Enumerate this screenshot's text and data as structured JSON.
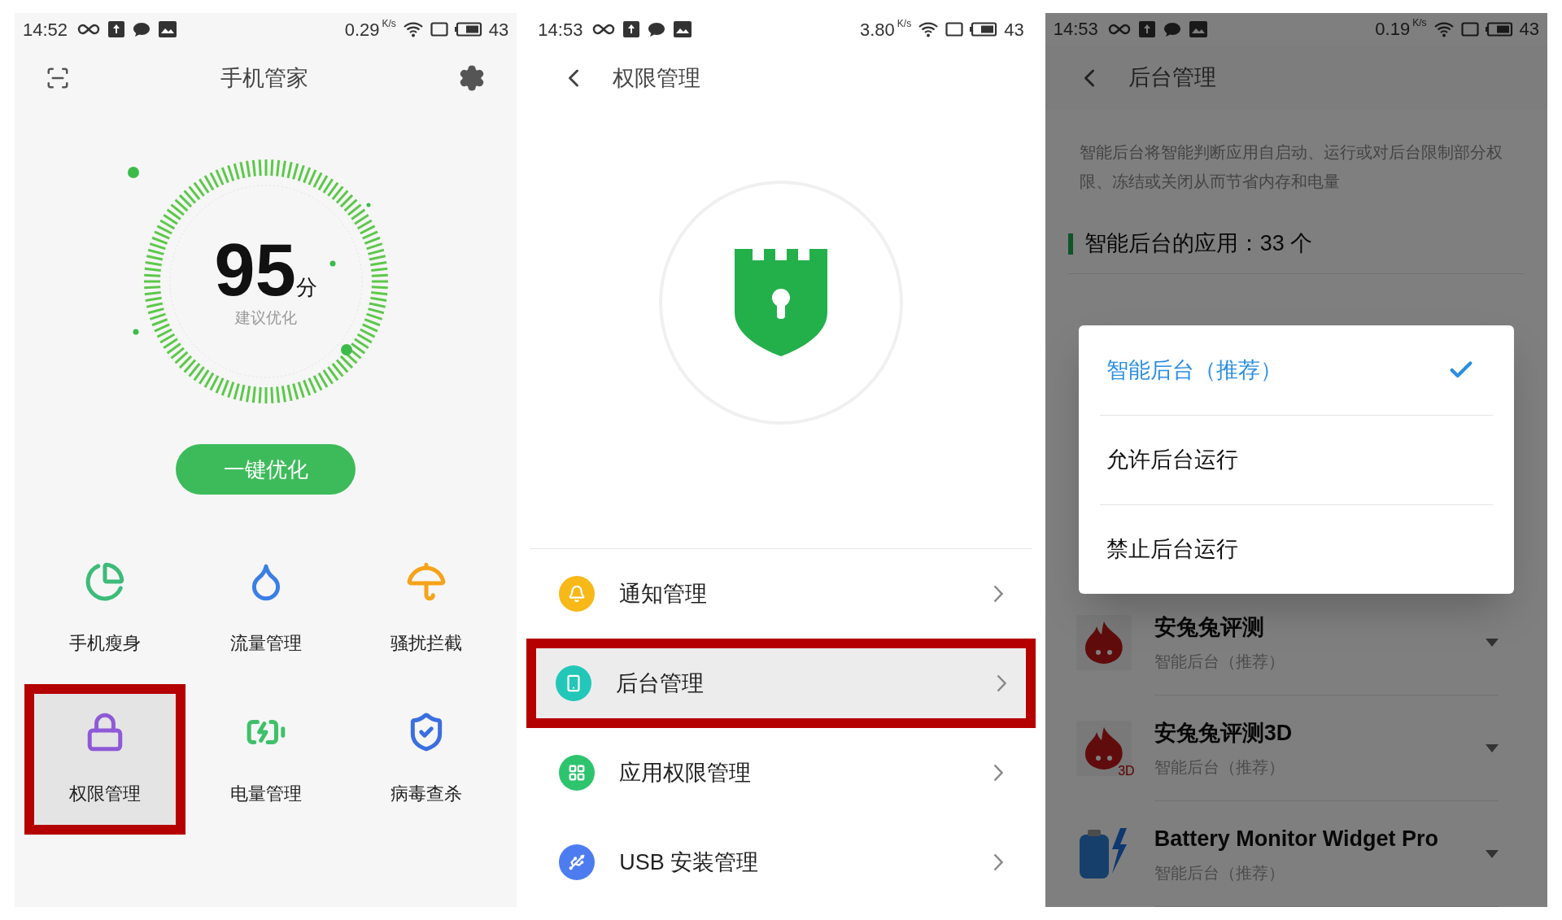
{
  "home_screen": {
    "status_bar": {
      "time": "14:52",
      "speed": "0.29",
      "speed_unit": "K/s",
      "battery": "43"
    },
    "title": "手机管家",
    "score": "95",
    "score_unit": "分",
    "score_caption": "建议优化",
    "optimize_button": "一键优化",
    "tools": [
      {
        "label": "手机瘦身",
        "kind": "pie",
        "color": "#3dbb7a",
        "highlighted": false
      },
      {
        "label": "流量管理",
        "kind": "drop",
        "color": "#3b7fe6",
        "highlighted": false
      },
      {
        "label": "骚扰拦截",
        "kind": "umbrella",
        "color": "#f5a31a",
        "highlighted": false
      },
      {
        "label": "权限管理",
        "kind": "lock",
        "color": "#8e5ad6",
        "highlighted": true
      },
      {
        "label": "电量管理",
        "kind": "battery",
        "color": "#3fc06a",
        "highlighted": false
      },
      {
        "label": "病毒查杀",
        "kind": "shield",
        "color": "#3a6fe0",
        "highlighted": false
      }
    ]
  },
  "permission_screen": {
    "status_bar": {
      "time": "14:53",
      "speed": "3.80",
      "speed_unit": "K/s",
      "battery": "43"
    },
    "title": "权限管理",
    "items": [
      {
        "label": "通知管理",
        "kind": "notice",
        "color": "#f7b818",
        "highlighted": false
      },
      {
        "label": "后台管理",
        "kind": "background",
        "color": "#22c7b8",
        "highlighted": true
      },
      {
        "label": "应用权限管理",
        "kind": "apps",
        "color": "#2ec46e",
        "highlighted": false
      },
      {
        "label": "USB 安装管理",
        "kind": "usb",
        "color": "#4d7cf0",
        "highlighted": false
      }
    ]
  },
  "background_screen": {
    "status_bar": {
      "time": "14:53",
      "speed": "0.19",
      "speed_unit": "K/s",
      "battery": "43"
    },
    "title": "后台管理",
    "description": "智能后台将智能判断应用自启动、运行或对后台限制部分权限、冻结或关闭从而节省内存和电量",
    "section_heading": "智能后台的应用：33 个",
    "apps": [
      {
        "name": "安兔兔评测",
        "status": "智能后台（推荐）",
        "kind": "flame"
      },
      {
        "name": "安兔兔评测3D",
        "status": "智能后台（推荐）",
        "kind": "flame",
        "badge": "3D"
      },
      {
        "name": "Battery Monitor Widget Pro",
        "status": "智能后台（推荐）",
        "kind": "battery"
      }
    ],
    "dialog": {
      "options": [
        {
          "label": "智能后台（推荐）",
          "selected": true
        },
        {
          "label": "允许后台运行",
          "selected": false
        },
        {
          "label": "禁止后台运行",
          "selected": false
        }
      ]
    }
  }
}
